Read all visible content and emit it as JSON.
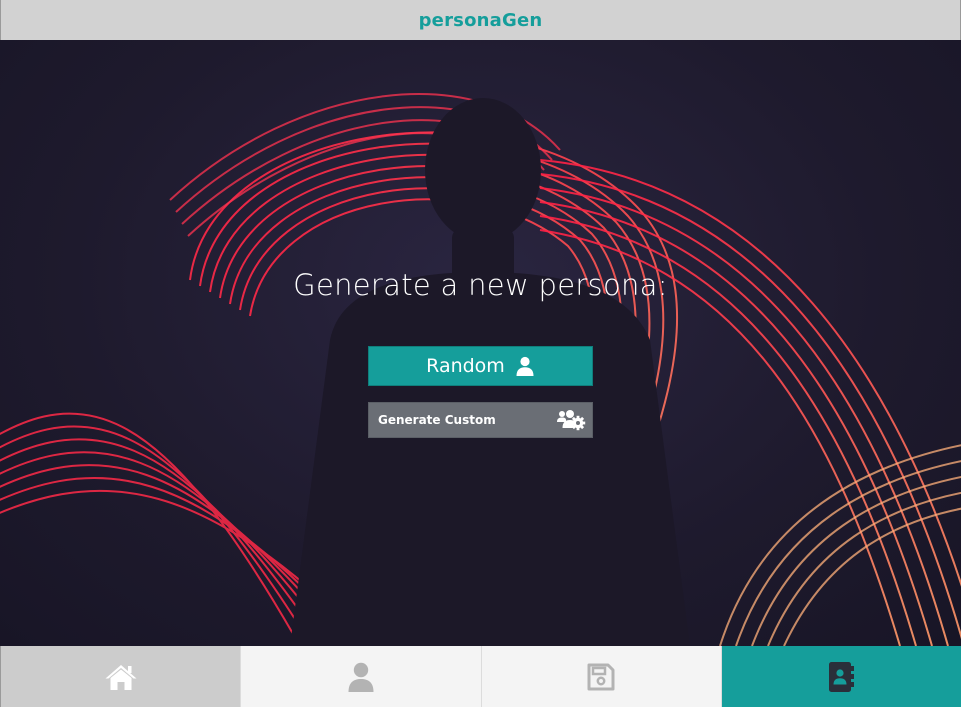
{
  "header": {
    "title": "personaGen"
  },
  "hero": {
    "heading": "Generate a new persona:",
    "random_button": {
      "label": "Random",
      "icon": "user-icon"
    },
    "custom_button": {
      "label": "Generate Custom",
      "icon": "users-cog-icon"
    }
  },
  "bottom_nav": {
    "items": [
      {
        "id": "home",
        "icon": "home-icon",
        "active": false
      },
      {
        "id": "persona",
        "icon": "user-icon",
        "active": false
      },
      {
        "id": "saved",
        "icon": "save-icon",
        "active": false
      },
      {
        "id": "contacts",
        "icon": "address-book-icon",
        "active": true
      }
    ]
  },
  "colors": {
    "accent": "#159e9b",
    "header_bg": "#d2d2d2",
    "custom_button_bg": "#6a6e75",
    "hero_bg": "#1e1a2d",
    "light_trails": "#ff2a48"
  }
}
